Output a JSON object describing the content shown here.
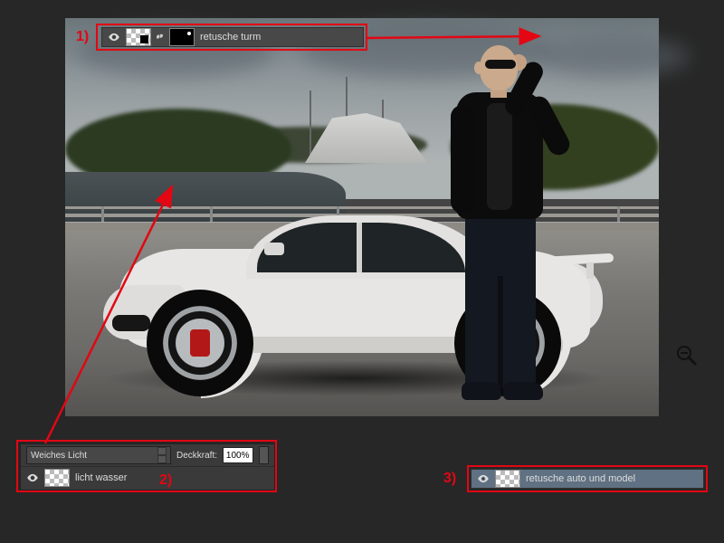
{
  "annotations": {
    "n1": "1)",
    "n2": "2)",
    "n3": "3)"
  },
  "layer1": {
    "name": "retusche turm"
  },
  "layer2": {
    "name": "licht wasser"
  },
  "layer3": {
    "name": "retusche auto und model"
  },
  "panel": {
    "blend_mode": "Weiches Licht",
    "opacity_label": "Deckkraft:",
    "opacity_value": "100%"
  },
  "icons": {
    "eye": "eye-icon",
    "link": "link-icon",
    "zoom": "zoom-out-icon"
  }
}
